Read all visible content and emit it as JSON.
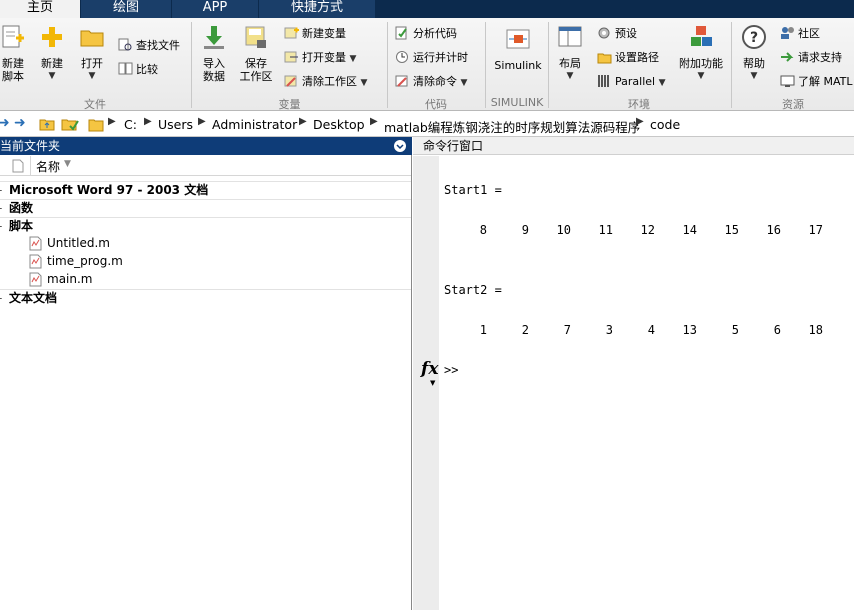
{
  "tabs": [
    "主页",
    "绘图",
    "APP",
    "快捷方式"
  ],
  "ribbon": {
    "file": {
      "new_script": "新建\n脚本",
      "new": "新建",
      "open": "打开",
      "find_files": "查找文件",
      "compare": "比较",
      "group": "文件"
    },
    "variable": {
      "import": "导入\n数据",
      "save_ws": "保存\n工作区",
      "new_var": "新建变量",
      "open_var": "打开变量",
      "clear_ws": "清除工作区",
      "group": "变量"
    },
    "code": {
      "analyze": "分析代码",
      "run_time": "运行并计时",
      "clear_cmd": "清除命令",
      "group": "代码"
    },
    "simulink": {
      "label": "Simulink",
      "group": "SIMULINK"
    },
    "environment": {
      "layout": "布局",
      "preferences": "预设",
      "set_path": "设置路径",
      "parallel": "Parallel",
      "addons": "附加功能",
      "group": "环境"
    },
    "resources": {
      "help": "帮助",
      "community": "社区",
      "request_support": "请求支持",
      "learn": "了解 MATL",
      "group": "资源"
    }
  },
  "address": [
    "C:",
    "Users",
    "Administrator",
    "Desktop",
    "matlab编程炼钢浇注的时序规划算法源码程序",
    "code"
  ],
  "left_panel": {
    "title": "当前文件夹",
    "col_name": "名称",
    "groups": [
      {
        "label": "Microsoft Word 97 - 2003 文档",
        "files": []
      },
      {
        "label": "函数",
        "files": []
      },
      {
        "label": "脚本",
        "files": [
          "Untitled.m",
          "time_prog.m",
          "main.m"
        ]
      },
      {
        "label": "文本文档",
        "files": []
      }
    ]
  },
  "command_window": {
    "title": "命令行窗口",
    "start1_label": "Start1 =",
    "start1_values": [
      "8",
      "9",
      "10",
      "11",
      "12",
      "14",
      "15",
      "16",
      "17"
    ],
    "start2_label": "Start2 =",
    "start2_values": [
      "1",
      "2",
      "7",
      "3",
      "4",
      "13",
      "5",
      "6",
      "18"
    ],
    "fx": "fx",
    "prompt": ">>"
  }
}
